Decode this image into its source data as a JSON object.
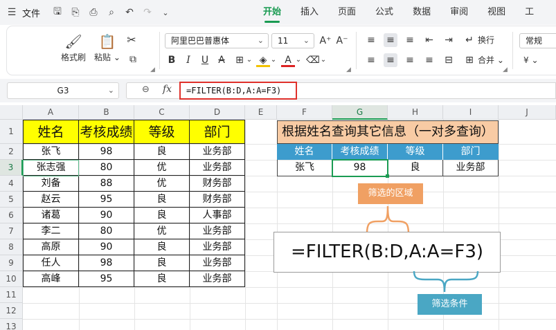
{
  "menubar": {
    "file_label": "文件",
    "tabs": [
      "开始",
      "插入",
      "页面",
      "公式",
      "数据",
      "审阅",
      "视图",
      "工"
    ],
    "active_tab": "开始"
  },
  "ribbon": {
    "format_painter": "格式刷",
    "paste": "粘贴",
    "font_name": "阿里巴巴普惠体",
    "font_size": "11",
    "wrap_text": "换行",
    "merge": "合并",
    "number_format": "常规",
    "currency_symbol": "¥"
  },
  "formula_bar": {
    "cell_ref": "G3",
    "fx": "fx",
    "formula": "=FILTER(B:D,A:A=F3)"
  },
  "sheet": {
    "columns": [
      "A",
      "B",
      "C",
      "D",
      "E",
      "F",
      "G",
      "H",
      "I",
      "J"
    ],
    "rows": [
      "1",
      "2",
      "3",
      "4",
      "5",
      "6",
      "7",
      "8",
      "9",
      "10",
      "11",
      "12",
      "13"
    ],
    "table1": {
      "headers": [
        "姓名",
        "考核成绩",
        "等级",
        "部门"
      ],
      "rows": [
        [
          "张飞",
          "98",
          "良",
          "业务部"
        ],
        [
          "张志强",
          "80",
          "优",
          "业务部"
        ],
        [
          "刘备",
          "88",
          "优",
          "财务部"
        ],
        [
          "赵云",
          "95",
          "良",
          "财务部"
        ],
        [
          "诸葛",
          "90",
          "良",
          "人事部"
        ],
        [
          "李二",
          "80",
          "优",
          "业务部"
        ],
        [
          "高原",
          "90",
          "良",
          "业务部"
        ],
        [
          "任人",
          "98",
          "良",
          "业务部"
        ],
        [
          "高峰",
          "95",
          "良",
          "业务部"
        ]
      ]
    },
    "table2": {
      "title": "根据姓名查询其它信息（一对多查询）",
      "headers": [
        "姓名",
        "考核成绩",
        "等级",
        "部门"
      ],
      "row": [
        "张飞",
        "98",
        "良",
        "业务部"
      ]
    },
    "callout_range": "筛选的区域",
    "callout_condition": "筛选条件",
    "big_formula": "=FILTER(B:D,A:A=F3)"
  },
  "colors": {
    "accent": "#1a9b52",
    "header_yellow": "#ffff00",
    "title_peach": "#f8cba4",
    "table_blue": "#3d9ccd",
    "callout_orange": "#f0a063",
    "callout_teal": "#4aa7c4",
    "highlight_red": "#e0312b"
  }
}
